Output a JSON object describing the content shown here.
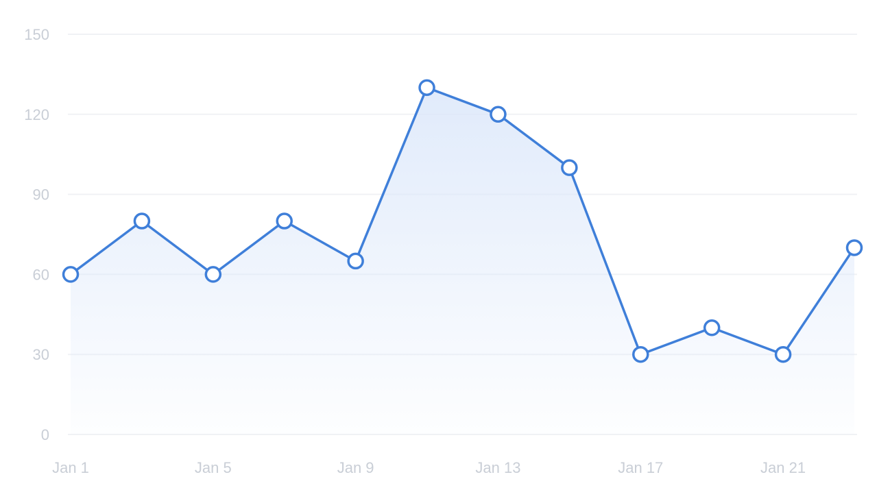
{
  "chart_data": {
    "type": "area",
    "title": "",
    "xlabel": "",
    "ylabel": "",
    "ylim": [
      0,
      150
    ],
    "y_ticks": [
      0,
      30,
      60,
      90,
      120,
      150
    ],
    "x_ticks": [
      "Jan 1",
      "Jan 5",
      "Jan 9",
      "Jan 13",
      "Jan 17",
      "Jan 21"
    ],
    "x": [
      "Jan 1",
      "Jan 3",
      "Jan 5",
      "Jan 7",
      "Jan 9",
      "Jan 11",
      "Jan 13",
      "Jan 15",
      "Jan 17",
      "Jan 19",
      "Jan 21",
      "Jan 23"
    ],
    "series": [
      {
        "values": [
          60,
          80,
          60,
          80,
          65,
          130,
          120,
          100,
          30,
          40,
          30,
          70
        ]
      }
    ],
    "grid": true,
    "legend": "none",
    "colors": {
      "line": "#3f7fd9",
      "area_top": "#dbe7fa",
      "marker_fill": "#ffffff",
      "grid": "#f0f2f5",
      "tick_label": "#c9ced6"
    }
  }
}
